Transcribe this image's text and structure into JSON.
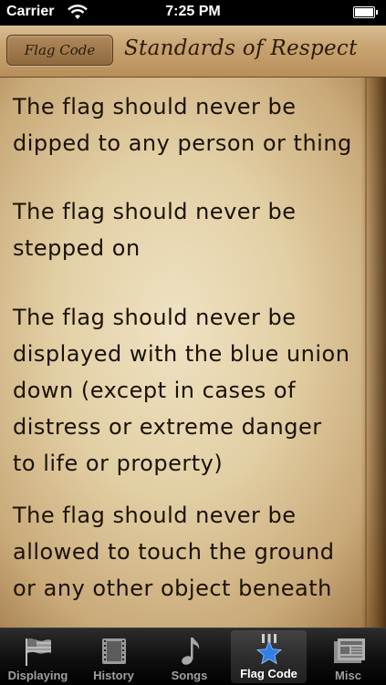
{
  "status_bar": {
    "carrier": "Carrier",
    "time": "7:25 PM",
    "icons": [
      "wifi-icon",
      "battery-icon"
    ]
  },
  "nav_bar": {
    "back_label": "Flag Code",
    "title": "Standards of Respect"
  },
  "content": {
    "rules": [
      {
        "lines": [
          "The flag should never be",
          "dipped to any person or thing"
        ]
      },
      {
        "lines": [
          "The flag should never be",
          "stepped on"
        ]
      },
      {
        "lines": [
          "The flag should never be",
          "displayed with the blue union",
          "down (except in cases of",
          "distress or extreme danger",
          "to life or property)"
        ]
      },
      {
        "lines": [
          "The flag should never be",
          "allowed to touch the ground",
          "or any other object beneath"
        ]
      }
    ]
  },
  "tab_bar": {
    "active": "Flag Code",
    "tabs": [
      {
        "label": "Displaying",
        "icon": "flag-icon"
      },
      {
        "label": "History",
        "icon": "film-icon"
      },
      {
        "label": "Songs",
        "icon": "music-note-icon"
      },
      {
        "label": "Flag Code",
        "icon": "star-icon"
      },
      {
        "label": "Misc",
        "icon": "newspaper-icon"
      }
    ]
  },
  "colors": {
    "nav_bar": "#c8a472",
    "paper": "#e2cfa4",
    "text": "#1a1208",
    "active_star": "#2f7fe8"
  }
}
